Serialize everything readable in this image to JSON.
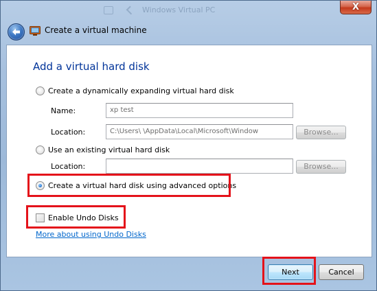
{
  "window": {
    "title": "Create a virtual machine",
    "background_title": "Windows Virtual PC",
    "close_label": "X"
  },
  "page": {
    "heading": "Add a virtual hard disk"
  },
  "options": {
    "dynamic": {
      "label": "Create a dynamically expanding virtual hard disk",
      "selected": false,
      "name_label": "Name:",
      "name_value": "xp test",
      "location_label": "Location:",
      "location_value": "C:\\Users\\            \\AppData\\Local\\Microsoft\\Window",
      "browse_label": "Browse..."
    },
    "existing": {
      "label": "Use an existing virtual hard disk",
      "selected": false,
      "location_label": "Location:",
      "location_value": "",
      "browse_label": "Browse..."
    },
    "advanced": {
      "label": "Create a virtual hard disk using advanced options",
      "selected": true
    }
  },
  "undo": {
    "checkbox_label": "Enable Undo Disks",
    "checked": false,
    "link_label": "More about using Undo Disks"
  },
  "footer": {
    "next_label": "Next",
    "cancel_label": "Cancel"
  },
  "colors": {
    "heading": "#003399",
    "link": "#0066cc",
    "highlight": "#e4121a"
  }
}
